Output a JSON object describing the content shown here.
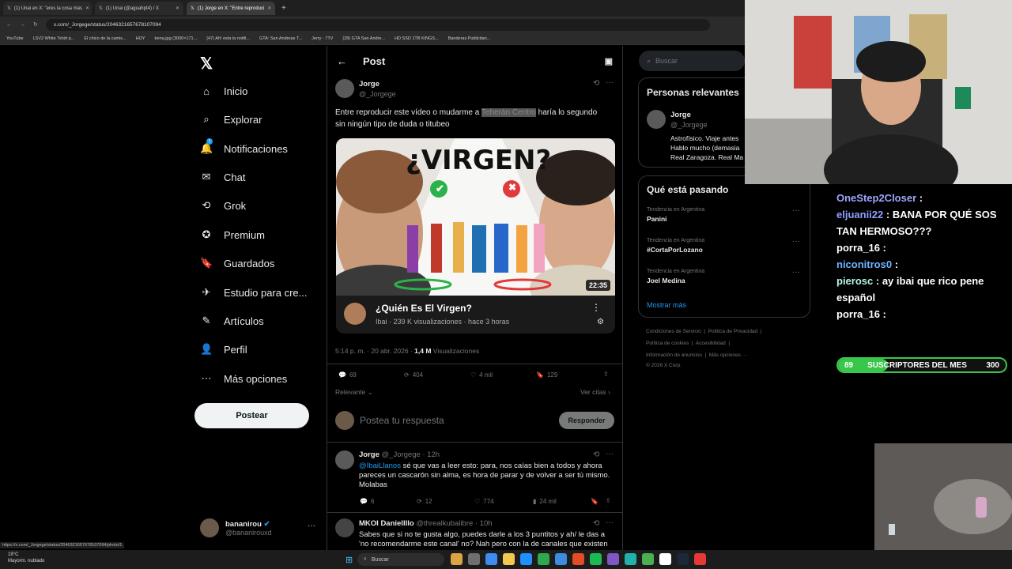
{
  "browser": {
    "tabs": [
      {
        "label": "(1) Unai en X: \"eres la cosa más"
      },
      {
        "label": "(1) Unai (@aguahpt4) / X"
      },
      {
        "label": "(1) Jorge en X: \"Entre reproduci"
      }
    ],
    "url": "x.com/_Jorgege/status/2046321657678107094",
    "bookmarks": [
      "YouTube",
      "LSV2 White Tshirt p...",
      "El chico de la camis...",
      "HOY",
      "bena.jpg (3000×171...",
      "(47) Ah! esta la notifi...",
      "GTA: San Andreas T...",
      "Jerry - 7TV",
      "(28) GTA San Andre...",
      "HD SSD 1TB KINGS...",
      "Banderas Publicitari..."
    ],
    "status_url": "https://x.com/_Jorgege/status/2046321657678107094/photo/1"
  },
  "nav": {
    "items": [
      "Inicio",
      "Explorar",
      "Notificaciones",
      "Chat",
      "Grok",
      "Premium",
      "Guardados",
      "Estudio para cre...",
      "Artículos",
      "Perfil",
      "Más opciones"
    ],
    "notif_count": "1",
    "post_button": "Postear",
    "account": {
      "name": "bananirou",
      "handle": "@bananirouxd"
    }
  },
  "post": {
    "header": "Post",
    "author": "Jorge",
    "handle": "@_Jorgege",
    "text_before": "Entre reproducir este vídeo o mudarme a ",
    "text_highlight": "Teherán Centro",
    "text_after": " haría lo segundo sin ningún tipo de duda o titubeo",
    "thumb_title": "¿VIRGEN?",
    "duration": "22:35",
    "video_title": "¿Quién Es El Virgen?",
    "video_meta": "Ibai · 239 K visualizaciones · hace 3 horas",
    "timestamp": "5:14 p. m. · 20 abr. 2026 · ",
    "views": "1,4 M",
    "views_label": " Visualizaciones",
    "stats": {
      "replies": "69",
      "reposts": "404",
      "likes": "4 mil",
      "bookmarks": "129"
    },
    "sort": "Relevante",
    "quotes": "Ver citas",
    "reply_placeholder": "Postea tu respuesta",
    "reply_button": "Responder"
  },
  "replies": [
    {
      "author": "Jorge",
      "handle": "@_Jorgege · 12h",
      "mention": "@IbaiLlanos",
      "text": " sé que vas a leer esto: para, nos caías bien a todos y ahora pareces un cascarón sin alma, es hora de parar y de volver a ser tú mismo. Molabas",
      "stats": {
        "replies": "6",
        "reposts": "12",
        "likes": "774",
        "views": "24 mil"
      }
    },
    {
      "author": "MKOI Daniellllo",
      "handle": "@threalkubalibre · 10h",
      "text": "Sabes que si no te gusta algo, puedes darle a los 3 puntitos y ah/ le das a 'no recomendarme este canal' no? Nah pero con la de canales que existen"
    }
  ],
  "sidebar": {
    "search_placeholder": "Buscar",
    "relevant_title": "Personas relevantes",
    "person": {
      "name": "Jorge",
      "handle": "@_Jorgege",
      "bio": "Astrofísico. Viaje antes Hablo mucho (demasia Real Zaragoza. Real Ma"
    },
    "trending_title": "Qué está pasando",
    "trends": [
      {
        "category": "Tendencia en Argentina",
        "name": "Panini"
      },
      {
        "category": "Tendencia en Argentina",
        "name": "#CortaPorLozano"
      },
      {
        "category": "Tendencia en Argentina",
        "name": "Joel Medina"
      }
    ],
    "show_more": "Mostrar más",
    "footer": [
      "Condiciones de Servicio",
      "Política de Privacidad",
      "Política de cookies",
      "Accesibilidad",
      "Información de anuncios",
      "Más opciones ···",
      "© 2026 X Corp."
    ]
  },
  "stream": {
    "chat": [
      {
        "user": "OneStep2Closer",
        "msg": ":",
        "color": "#9ea7ff"
      },
      {
        "user": "eljuanii22",
        "msg": ": BANA POR QUÉ SOS TAN HERMOSO???",
        "color": "#8fa0ff"
      },
      {
        "user": "porra_16",
        "msg": ":",
        "color": "#ffffff"
      },
      {
        "user": "niconitros0",
        "msg": ":",
        "color": "#6fb4ff"
      },
      {
        "user": "pierosc",
        "msg": ": ay ibai que rico pene español",
        "color": "#b5f5e8"
      },
      {
        "user": "porra_16",
        "msg": ":",
        "color": "#ffffff"
      }
    ],
    "sub_label": "SUSCRIPTORES DEL MES",
    "sub_current": "89",
    "sub_goal": "300",
    "sub_progress": 0.2967
  },
  "taskbar": {
    "weather_temp": "19°C",
    "weather_desc": "Mayorm. nublado",
    "search": "Buscar"
  },
  "colors": {
    "accent": "#1d9bf0",
    "background": "#000000",
    "sub_green": "#39c74b"
  }
}
